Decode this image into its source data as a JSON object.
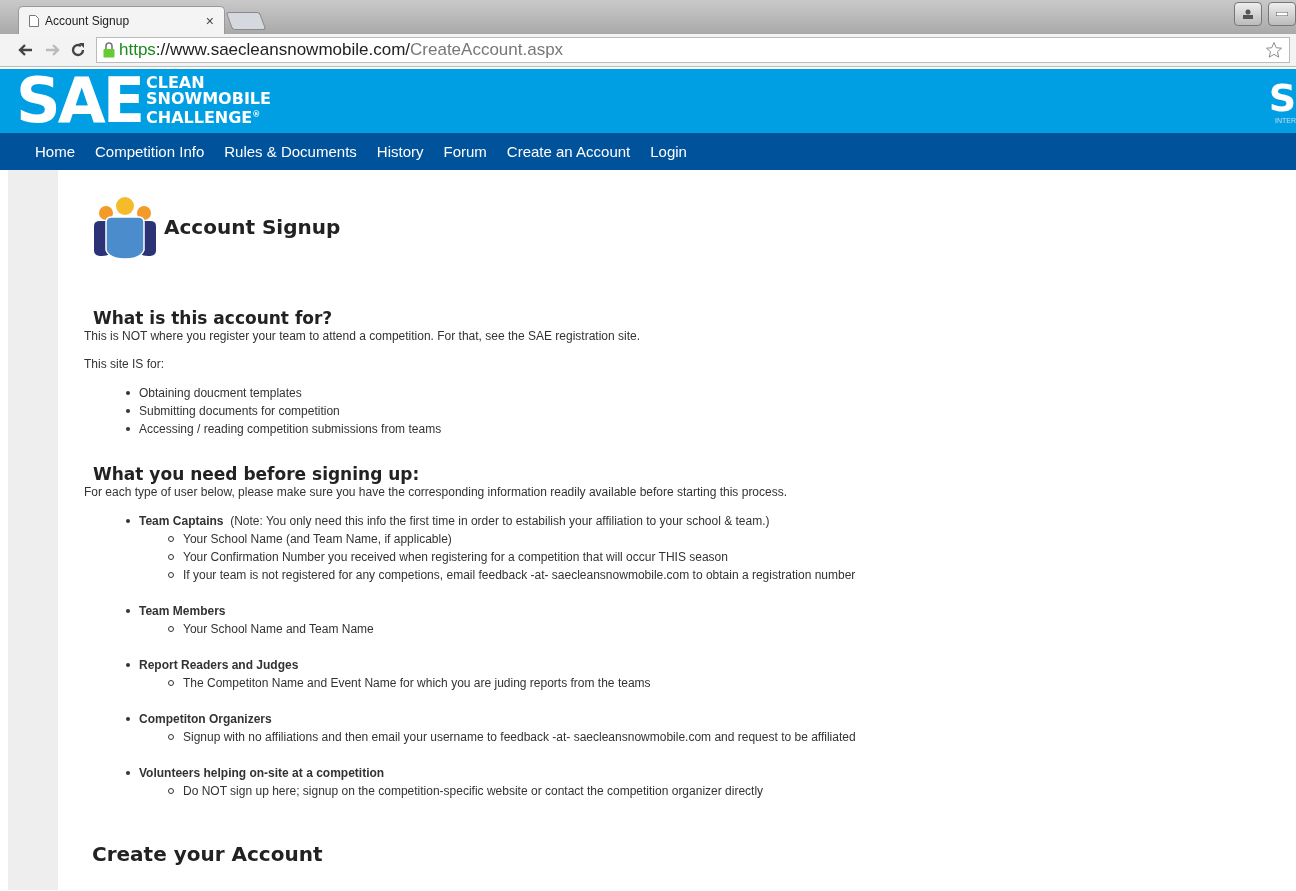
{
  "browser": {
    "tab_title": "Account Signup",
    "tab_close": "×",
    "url_scheme": "https",
    "url_host": "://www.saecleansnowmobile.com/",
    "url_path": "CreateAccount.aspx"
  },
  "header": {
    "logo_main": "SAE",
    "logo_lines": [
      "CLEAN",
      "SNOWMOBILE",
      "CHALLENGE"
    ],
    "logo_mark": "®",
    "right_logo": "S",
    "right_logo_sub": "INTER"
  },
  "nav": [
    {
      "label": "Home"
    },
    {
      "label": "Competition Info"
    },
    {
      "label": "Rules & Documents"
    },
    {
      "label": "History"
    },
    {
      "label": "Forum"
    },
    {
      "label": "Create an Account"
    },
    {
      "label": "Login"
    }
  ],
  "page_title": "Account Signup",
  "section_1": {
    "heading": "What is this account for?",
    "paragraphs": [
      "This is NOT where you register your team to attend a competition.  For that, see the SAE registration site.",
      "This site IS for:"
    ],
    "items": [
      "Obtaining doucment templates",
      "Submitting documents for competition",
      "Accessing / reading competition submissions from teams"
    ]
  },
  "section_2": {
    "heading": "What you need before signing up:",
    "intro": "For each type of user below, please make sure you have the corresponding information readily available before starting this process.",
    "groups": [
      {
        "title": "Team Captains",
        "note": "(Note: You only need this info the first time in order to estabilish your affiliation to your school & team.)",
        "items": [
          "Your School Name (and Team Name, if applicable)",
          "Your Confirmation Number you received when registering for a competition that will occur THIS season",
          "If your team is not registered for any competions, email feedback -at- saecleansnowmobile.com to obtain a registration number"
        ]
      },
      {
        "title": "Team Members",
        "items": [
          "Your School Name and Team Name"
        ]
      },
      {
        "title": "Report Readers and Judges",
        "items": [
          "The Competiton Name and Event Name for which you are juding reports from the teams"
        ]
      },
      {
        "title": "Competiton Organizers",
        "items": [
          "Signup with no affiliations and then email your username to feedback -at- saecleansnowmobile.com and request to be affiliated"
        ]
      },
      {
        "title": "Volunteers helping on-site at a competition",
        "items": [
          "Do NOT sign up here; signup on the competition-specific website or contact the competition organizer directly"
        ]
      }
    ]
  },
  "section_3": {
    "heading": "Create your Account"
  }
}
